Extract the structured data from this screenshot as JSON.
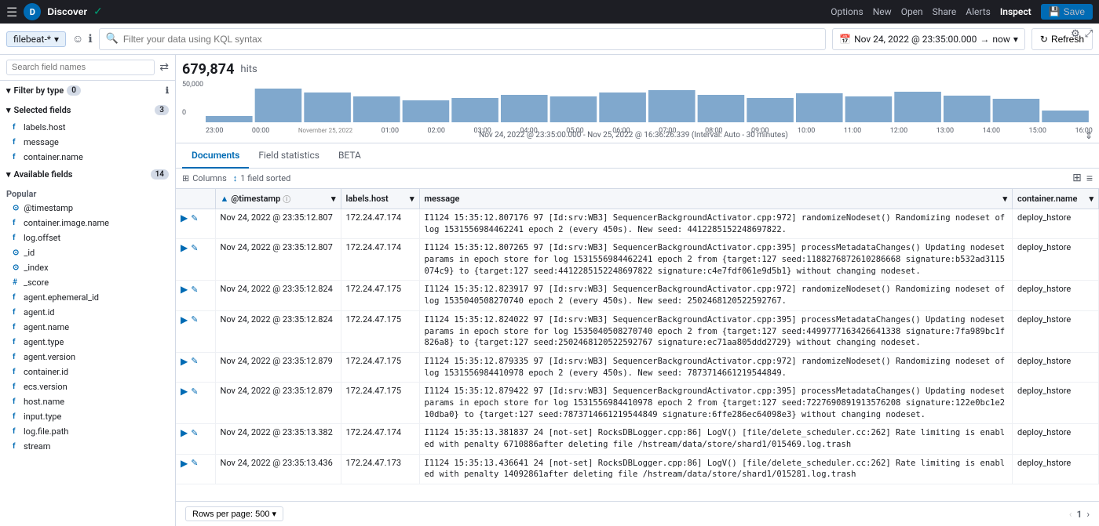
{
  "topnav": {
    "options": "Options",
    "new": "New",
    "open": "Open",
    "share": "Share",
    "alerts": "Alerts",
    "inspect": "Inspect",
    "save": "Save",
    "avatar_initials": "D",
    "discover_label": "Discover"
  },
  "toolbar2": {
    "index_label": "filebeat-*",
    "search_placeholder": "Filter your data using KQL syntax",
    "time_range": "Nov 24, 2022 @ 23:35:00.000",
    "time_arrow": "→",
    "time_now": "now",
    "refresh_label": "Refresh"
  },
  "sidebar": {
    "search_placeholder": "Search field names",
    "filter_type_label": "Filter by type",
    "filter_type_count": "0",
    "selected_fields_label": "Selected fields",
    "selected_fields_count": "3",
    "available_fields_label": "Available fields",
    "available_fields_count": "14",
    "popular_label": "Popular",
    "selected_fields": [
      {
        "name": "labels.host",
        "type": "f"
      },
      {
        "name": "message",
        "type": "f"
      },
      {
        "name": "container.name",
        "type": "f"
      }
    ],
    "popular_fields": [
      {
        "name": "@timestamp",
        "type": "⊙"
      },
      {
        "name": "container.image.name",
        "type": "f"
      },
      {
        "name": "log.offset",
        "type": "f"
      }
    ],
    "available_fields": [
      {
        "name": "_id",
        "type": "⊙"
      },
      {
        "name": "_index",
        "type": "⊙"
      },
      {
        "name": "_score",
        "type": "#"
      },
      {
        "name": "agent.ephemeral_id",
        "type": "f"
      },
      {
        "name": "agent.id",
        "type": "f"
      },
      {
        "name": "agent.name",
        "type": "f"
      },
      {
        "name": "agent.type",
        "type": "f"
      },
      {
        "name": "agent.version",
        "type": "f"
      },
      {
        "name": "container.id",
        "type": "f"
      },
      {
        "name": "ecs.version",
        "type": "f"
      },
      {
        "name": "host.name",
        "type": "f"
      },
      {
        "name": "input.type",
        "type": "f"
      },
      {
        "name": "log.file.path",
        "type": "f"
      },
      {
        "name": "stream",
        "type": "f"
      }
    ]
  },
  "chart": {
    "hits_count": "679,874",
    "hits_label": "hits",
    "time_labels": [
      "23:00",
      "00:00",
      "01:00",
      "02:00",
      "03:00",
      "04:00",
      "05:00",
      "06:00",
      "07:00",
      "08:00",
      "09:00",
      "10:00",
      "11:00",
      "12:00",
      "13:00",
      "14:00",
      "15:00",
      "16:00"
    ],
    "date_label": "November 25, 2022",
    "y_max": "50,000",
    "y_zero": "0",
    "subtitle": "Nov 24, 2022 @ 23:35:00.000 - Nov 25, 2022 @ 16:36:26.339 (Interval: Auto - 30 minutes)"
  },
  "tabs": [
    {
      "label": "Documents",
      "active": true
    },
    {
      "label": "Field statistics",
      "active": false
    },
    {
      "label": "BETA",
      "active": false
    }
  ],
  "table_toolbar": {
    "columns_label": "Columns",
    "sort_label": "1 field sorted"
  },
  "table": {
    "columns": [
      "@timestamp",
      "labels.host",
      "message",
      "container.name"
    ],
    "rows": [
      {
        "timestamp": "Nov 24, 2022 @ 23:35:12.807",
        "labels_host": "172.24.47.174",
        "message": "I1124 15:35:12.807176   97 [Id:srv:WB3] SequencerBackgroundActivator.cpp:972] randomizeNodeset() Randomizing nodeset of log 1531556984462241 epoch 2 (every 450s). New seed: 4412285152248697822.",
        "container_name": "deploy_hstore"
      },
      {
        "timestamp": "Nov 24, 2022 @ 23:35:12.807",
        "labels_host": "172.24.47.174",
        "message": "I1124 15:35:12.807265   97 [Id:srv:WB3] SequencerBackgroundActivator.cpp:395] processMetadataChanges() Updating nodeset params in epoch store for log 1531556984462241 epoch 2 from {target:127 seed:1188276872610286668 signature:b532ad3115074c9} to {target:127 seed:4412285152248697822 signature:c4e7fdf061e9d5b1} without changing nodeset.",
        "container_name": "deploy_hstore"
      },
      {
        "timestamp": "Nov 24, 2022 @ 23:35:12.824",
        "labels_host": "172.24.47.175",
        "message": "I1124 15:35:12.823917   97 [Id:srv:WB3] SequencerBackgroundActivator.cpp:972] randomizeNodeset() Randomizing nodeset of log 1535040508270740 epoch 2 (every 450s). New seed: 2502468120522592767.",
        "container_name": "deploy_hstore"
      },
      {
        "timestamp": "Nov 24, 2022 @ 23:35:12.824",
        "labels_host": "172.24.47.175",
        "message": "I1124 15:35:12.824022   97 [Id:srv:WB3] SequencerBackgroundActivator.cpp:395] processMetadataChanges() Updating nodeset params in epoch store for log 1535040508270740 epoch 2 from {target:127 seed:4499777163426641338 signature:7fa989bc1f826a8} to {target:127 seed:2502468120522592767 signature:ec71aa805ddd2729} without changing nodeset.",
        "container_name": "deploy_hstore"
      },
      {
        "timestamp": "Nov 24, 2022 @ 23:35:12.879",
        "labels_host": "172.24.47.175",
        "message": "I1124 15:35:12.879335   97 [Id:srv:WB3] SequencerBackgroundActivator.cpp:972] randomizeNodeset() Randomizing nodeset of log 1531556984410978 epoch 2 (every 450s). New seed: 7873714661219544849.",
        "container_name": "deploy_hstore"
      },
      {
        "timestamp": "Nov 24, 2022 @ 23:35:12.879",
        "labels_host": "172.24.47.175",
        "message": "I1124 15:35:12.879422   97 [Id:srv:WB3] SequencerBackgroundActivator.cpp:395] processMetadataChanges() Updating nodeset params in epoch store for log 1531556984410978 epoch 2 from {target:127 seed:7227690891913576208 signature:122e0bc1e210dba0} to {target:127 seed:7873714661219544849 signature:6ffe286ec64098e3} without changing nodeset.",
        "container_name": "deploy_hstore"
      },
      {
        "timestamp": "Nov 24, 2022 @ 23:35:13.382",
        "labels_host": "172.24.47.174",
        "message": "I1124 15:35:13.381837   24 [not-set] RocksDBLogger.cpp:86] LogV() [file/delete_scheduler.cc:262] Rate limiting is enabled with penalty 6710886after deleting file /hstream/data/store/shard1/015469.log.trash",
        "container_name": "deploy_hstore"
      },
      {
        "timestamp": "Nov 24, 2022 @ 23:35:13.436",
        "labels_host": "172.24.47.173",
        "message": "I1124 15:35:13.436641   24 [not-set] RocksDBLogger.cpp:86] LogV() [file/delete_scheduler.cc:262] Rate limiting is enabled with penalty 14092861after deleting file /hstream/data/store/shard1/015281.log.trash",
        "container_name": "deploy_hstore"
      }
    ]
  },
  "footer": {
    "rows_per_page_label": "Rows per page: 500",
    "page_num": "1",
    "next_label": "›"
  }
}
